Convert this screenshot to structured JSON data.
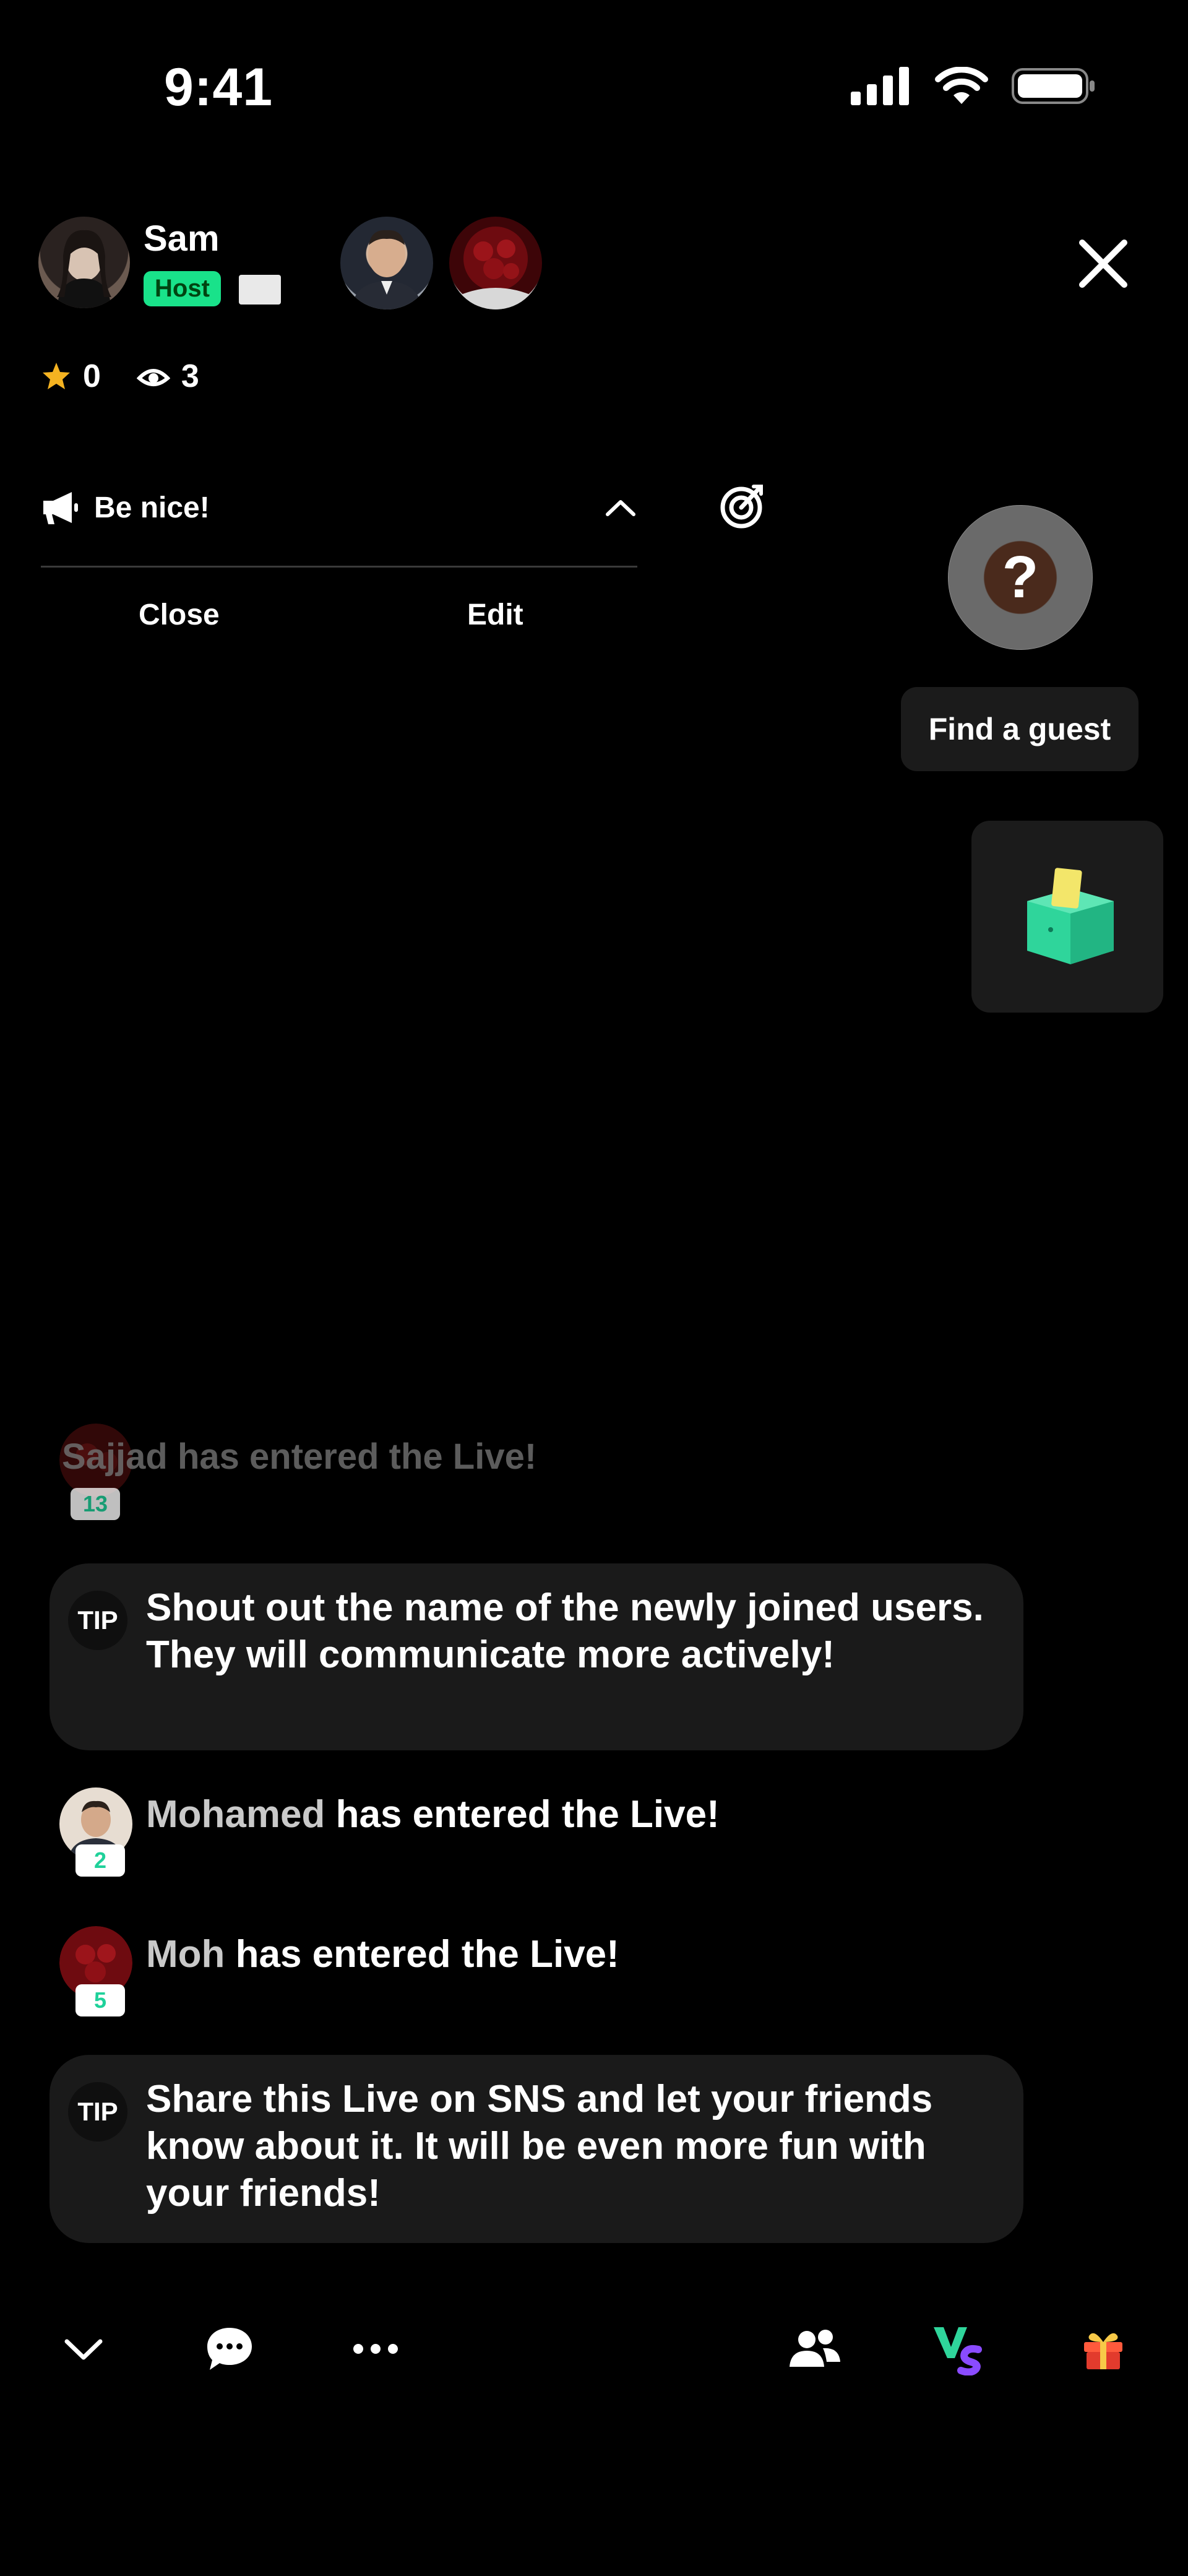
{
  "status_bar": {
    "time": "9:41"
  },
  "host": {
    "name": "Sam",
    "role_badge": "Host"
  },
  "stats": {
    "stars": "0",
    "viewers": "3"
  },
  "notice": {
    "text": "Be nice!",
    "close_label": "Close",
    "edit_label": "Edit"
  },
  "find_guest": {
    "question_mark": "?",
    "label": "Find a guest"
  },
  "chat": {
    "faded_message": "Sajjad has entered the Live!",
    "faded_level": "13",
    "tip1": {
      "label": "TIP",
      "text": "Shout out the name of the newly joined users. They will communicate more actively!"
    },
    "msg1": {
      "user": "Mohamed",
      "text": " has entered the Live!",
      "level": "2"
    },
    "msg2": {
      "user": "Moh",
      "text": " has entered the Live!",
      "level": "5"
    },
    "tip2": {
      "label": "TIP",
      "text": "Share this Live on SNS and let your friends know about it. It will be even more fun with your friends!"
    }
  },
  "colors": {
    "accent_green": "#19e28a",
    "level_green": "#1fd19a",
    "star": "#f5b321",
    "gift_red": "#e23b2d"
  }
}
